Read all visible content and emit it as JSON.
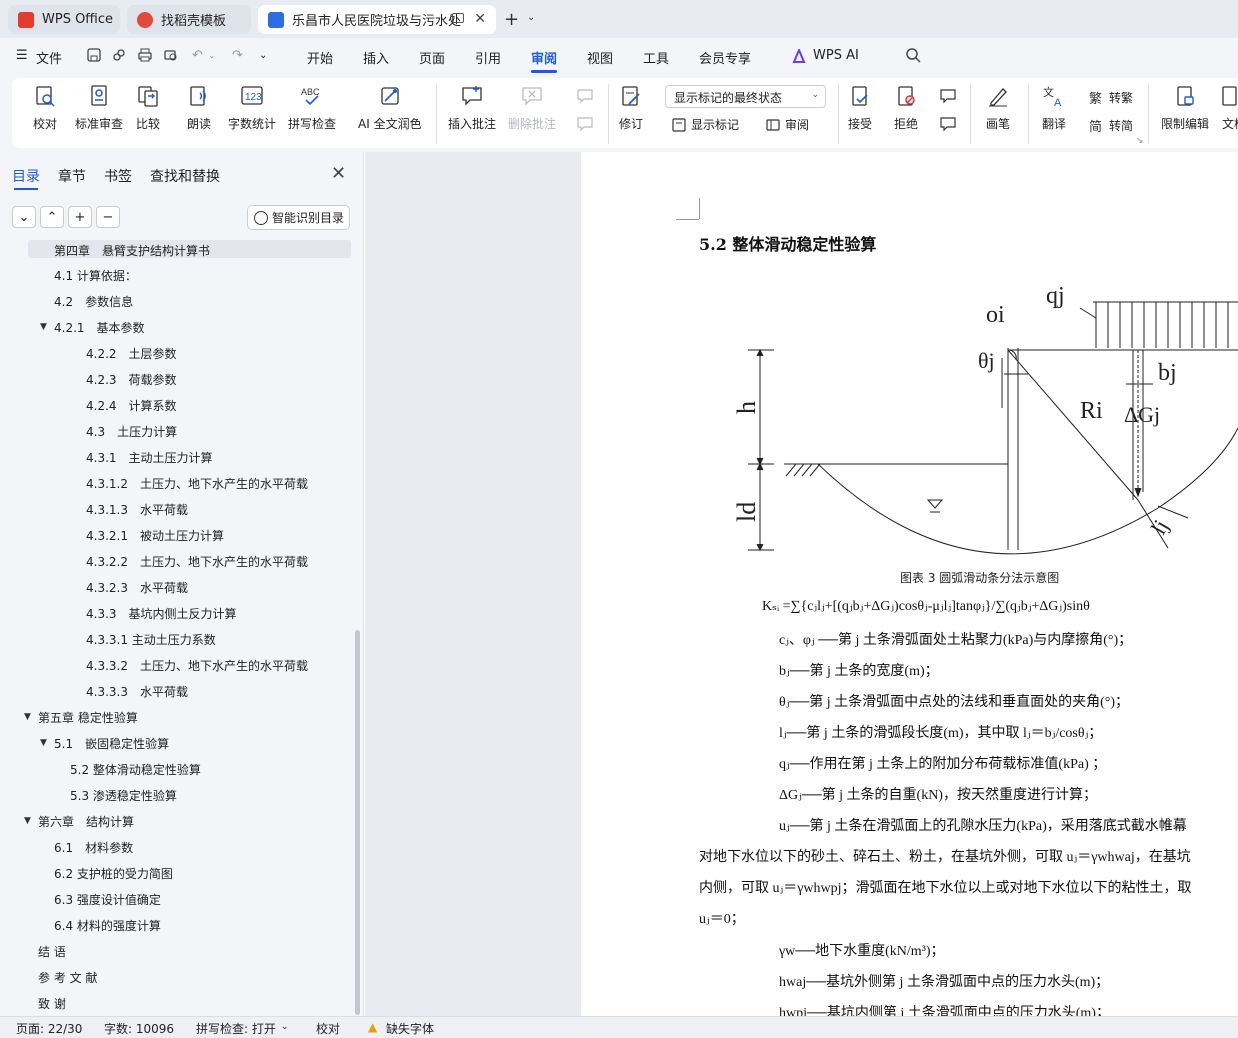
{
  "tabs": [
    {
      "label": "WPS Office",
      "color": "#e43b2c"
    },
    {
      "label": "找稻壳模板",
      "color": "#e24a3b"
    },
    {
      "label": "乐昌市人民医院垃圾与污水处",
      "color": "#2b6de4",
      "close": "✕"
    }
  ],
  "new_tab": "+",
  "menu": {
    "file": "文件",
    "items": [
      "开始",
      "插入",
      "页面",
      "引用",
      "审阅",
      "视图",
      "工具",
      "会员专享"
    ],
    "active": "审阅",
    "wps_ai": "WPS AI"
  },
  "ribbon": {
    "proofread": "校对",
    "standard_review": "标准审查",
    "compare": "比较",
    "read_aloud": "朗读",
    "word_count": "字数统计",
    "spell_check": "拼写检查",
    "ai_polish": "AI 全文润色",
    "insert_comment": "插入批注",
    "delete_comment": "删除批注",
    "revise": "修订",
    "markup_state": "显示标记的最终状态",
    "show_markup": "显示标记",
    "review": "审阅",
    "accept": "接受",
    "reject": "拒绝",
    "pen": "画笔",
    "translate": "翻译",
    "to_traditional": "转繁",
    "to_simplified": "转简",
    "restrict_edit": "限制编辑",
    "doc_partial": "文档"
  },
  "panel": {
    "tabs": [
      "目录",
      "章节",
      "书签",
      "查找和替换"
    ],
    "active_tab": "目录",
    "ai_toc": "智能识别目录",
    "toc": [
      {
        "text": "第四章　悬臂支护结构计算书"
      },
      {
        "text": "4.1 计算依据："
      },
      {
        "text": "4.2　参数信息"
      },
      {
        "text": "4.2.1　基本参数"
      },
      {
        "text": "4.2.2　土层参数"
      },
      {
        "text": "4.2.3　荷载参数"
      },
      {
        "text": "4.2.4　计算系数"
      },
      {
        "text": "4.3　土压力计算"
      },
      {
        "text": "4.3.1　主动土压力计算"
      },
      {
        "text": "4.3.1.2　土压力、地下水产生的水平荷载"
      },
      {
        "text": "4.3.1.3　水平荷载"
      },
      {
        "text": "4.3.2.1　被动土压力计算"
      },
      {
        "text": "4.3.2.2　土压力、地下水产生的水平荷载"
      },
      {
        "text": "4.3.2.3　水平荷载"
      },
      {
        "text": "4.3.3　基坑内侧土反力计算"
      },
      {
        "text": "4.3.3.1 主动土压力系数"
      },
      {
        "text": "4.3.3.2　土压力、地下水产生的水平荷载"
      },
      {
        "text": "4.3.3.3　水平荷载"
      },
      {
        "text": "第五章 稳定性验算"
      },
      {
        "text": "5.1　嵌固稳定性验算"
      },
      {
        "text": "5.2 整体滑动稳定性验算"
      },
      {
        "text": "5.3 渗透稳定性验算"
      },
      {
        "text": "第六章　结构计算"
      },
      {
        "text": "6.1　材料参数"
      },
      {
        "text": "6.2 支护桩的受力简图"
      },
      {
        "text": "6.3 强度设计值确定"
      },
      {
        "text": "6.4 材料的强度计算"
      },
      {
        "text": "结 语"
      },
      {
        "text": "参 考 文 献"
      },
      {
        "text": "致 谢"
      }
    ]
  },
  "document": {
    "heading": "5.2  整体滑动稳定性验算",
    "figure_labels": {
      "qj": "qj",
      "oi": "oi",
      "thetaj": "θj",
      "bj": "bj",
      "ri": "Ri",
      "dgj": "ΔGj",
      "h": "h",
      "ld": "ld",
      "lj": "lj"
    },
    "caption": "图表 3 圆弧滑动条分法示意图",
    "formula": "Kₛᵢ =∑{cⱼlⱼ+[(qⱼbⱼ+ΔGⱼ)cosθⱼ-μⱼlⱼ]tanφⱼ}/∑(qⱼbⱼ+ΔGⱼ)sinθ",
    "lines": [
      "cⱼ、φⱼ ──第 j 土条滑弧面处土粘聚力(kPa)与内摩擦角(°)；",
      "bⱼ──第 j 土条的宽度(m)；",
      "θⱼ──第 j 土条滑弧面中点处的法线和垂直面处的夹角(°)；",
      "lⱼ──第 j 土条的滑弧段长度(m)，其中取 lⱼ＝bⱼ/cosθⱼ；",
      "qⱼ──作用在第 j 土条上的附加分布荷载标准值(kPa) ；",
      "ΔGⱼ──第 j 土条的自重(kN)，按天然重度进行计算；",
      "uⱼ──第 j 土条在滑弧面上的孔隙水压力(kPa)，采用落底式截水帷幕",
      "对地下水位以下的砂土、碎石土、粉土，在基坑外侧，可取 uⱼ＝γwhwaj，在基坑",
      "内侧，可取 uⱼ＝γwhwpj；滑弧面在地下水位以上或对地下水位以下的粘性土，取",
      "uⱼ＝0；",
      "γw──地下水重度(kN/m³)；",
      "hwaj──基坑外侧第 j 土条滑弧面中点的压力水头(m)；",
      "hwpj──基坑内侧第 j 土条滑弧面中点的压力水头(m)；"
    ]
  },
  "status": {
    "page": "页面: 22/30",
    "words": "字数: 10096",
    "spell": "拼写检查: 打开",
    "proof": "校对",
    "missing_font": "缺失字体"
  }
}
